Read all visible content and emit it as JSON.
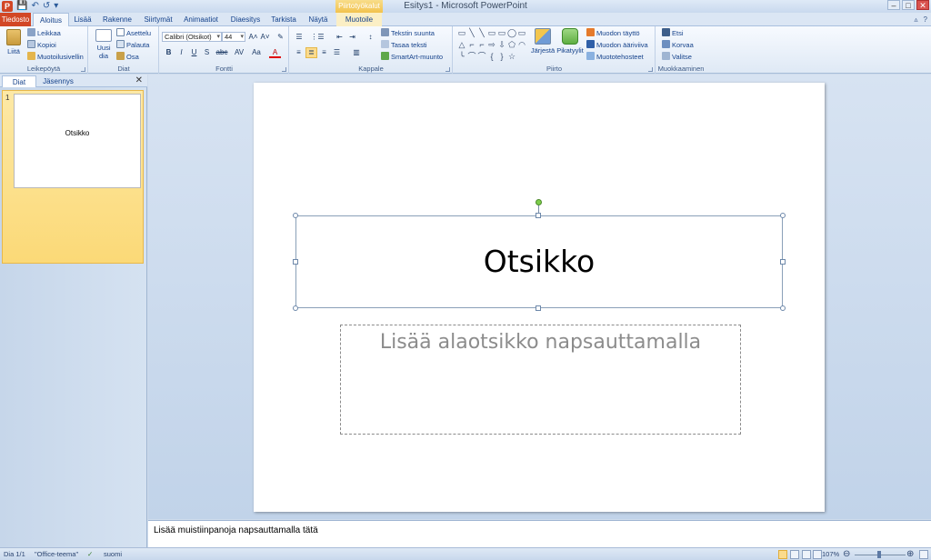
{
  "titlebar": {
    "title": "Esitys1 - Microsoft PowerPoint",
    "contextual_tools": "Piirtotyökalut",
    "app_icon": "P",
    "qat": {
      "save_icon": "💾",
      "undo_icon": "↶",
      "redo_icon": "↺",
      "customize_icon": "▾"
    },
    "controls": {
      "minimize": "–",
      "maximize": "□",
      "close": "✕"
    }
  },
  "tabs": {
    "file": "Tiedosto",
    "home": "Aloitus",
    "insert": "Lisää",
    "design": "Rakenne",
    "transitions": "Siirtymät",
    "animations": "Animaatiot",
    "slideshow": "Diaesitys",
    "review": "Tarkista",
    "view": "Näytä",
    "format": "Muotoile",
    "minimize_ribbon_icon": "▵",
    "help_icon": "?"
  },
  "ribbon": {
    "clipboard": {
      "label": "Leikepöytä",
      "paste": "Liitä",
      "cut": "Leikkaa",
      "copy": "Kopioi",
      "format_painter": "Muotoilusivellin"
    },
    "slides": {
      "label": "Diat",
      "new_slide_line1": "Uusi",
      "new_slide_line2": "dia",
      "layout": "Asettelu",
      "reset": "Palauta",
      "section": "Osa"
    },
    "font": {
      "label": "Fontti",
      "font_name": "Calibri (Otsikot)",
      "font_size": "44",
      "grow": "A˄",
      "shrink": "A˅",
      "clear": "✎",
      "bold": "B",
      "italic": "I",
      "underline": "U",
      "strike": "S",
      "shadow": "abc",
      "spacing": "AV",
      "case": "Aa",
      "color": "A"
    },
    "paragraph": {
      "label": "Kappale",
      "bullets": "☰",
      "numbering": "⋮☰",
      "decrease_indent": "⇤",
      "increase_indent": "⇥",
      "line_spacing": "↕",
      "text_direction": "Tekstin suunta",
      "align_text": "Tasaa teksti",
      "smartart": "SmartArt-muunto",
      "align_left": "≡",
      "align_center": "≣",
      "align_right": "≡",
      "justify": "☰",
      "columns": "▥"
    },
    "drawing": {
      "label": "Piirto",
      "arrange": "Järjestä",
      "quick_styles": "Pikatyylit",
      "shape_fill": "Muodon täyttö",
      "shape_outline": "Muodon ääriviiva",
      "shape_effects": "Muototehosteet",
      "shapes": [
        "▭",
        "╲",
        "╲",
        "▭",
        "▭",
        "◯",
        "▭",
        "△",
        "⌐",
        "⌐",
        "⇨",
        "⇩",
        "⬠",
        "◠",
        "╰",
        "⌒",
        "⌒",
        "{",
        "}",
        "☆"
      ]
    },
    "editing": {
      "label": "Muokkaaminen",
      "find": "Etsi",
      "replace": "Korvaa",
      "select": "Valitse"
    }
  },
  "pane": {
    "tab_slides": "Diat",
    "tab_outline": "Jäsennys",
    "close_icon": "✕",
    "thumb_number": "1",
    "thumb_title": "Otsikko"
  },
  "slide": {
    "title": "Otsikko",
    "subtitle_placeholder": "Lisää alaotsikko napsauttamalla"
  },
  "notes": {
    "placeholder": "Lisää muistiinpanoja napsauttamalla tätä"
  },
  "status": {
    "slide_info": "Dia 1/1",
    "theme": "\"Office-teema\"",
    "language": "suomi",
    "zoom": "107%",
    "zoom_out": "⊖",
    "zoom_in": "⊕",
    "spell_icon": "✓"
  },
  "colors": {
    "accent_file_tab": "#d24726",
    "selection_yellow": "#fbdb8d",
    "ribbon_text": "#15428b"
  }
}
